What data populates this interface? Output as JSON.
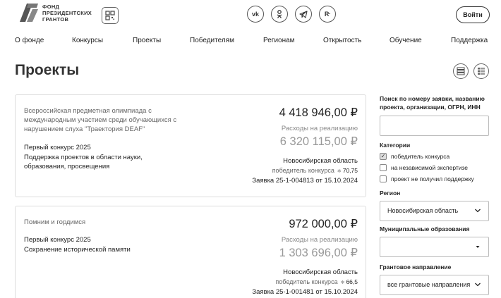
{
  "header": {
    "logo_text": [
      "ФОНД",
      "ПРЕЗИДЕНТСКИХ",
      "ГРАНТОВ"
    ],
    "login_label": "Войти",
    "socials": [
      {
        "icon": "vk-icon",
        "glyph": "vk"
      },
      {
        "icon": "odnoklassniki-icon",
        "glyph": "ok"
      },
      {
        "icon": "telegram-icon",
        "glyph": "tg"
      },
      {
        "icon": "rutube-icon",
        "glyph": "R"
      }
    ]
  },
  "nav": {
    "items": [
      "О фонде",
      "Конкурсы",
      "Проекты",
      "Победителям",
      "Регионам",
      "Открытость",
      "Обучение",
      "Поддержка"
    ]
  },
  "page": {
    "title": "Проекты"
  },
  "projects": [
    {
      "title": "Всероссийская предметная олимпиада с международным участием среди обучающихся с нарушением слуха \"Траектория DEAF\"",
      "contest": "Первый конкурс 2025",
      "direction": "Поддержка проектов в области науки, образования, просвещения",
      "amount": "4 418 946,00 ₽",
      "expenses_label": "Расходы на реализацию",
      "expenses_amount": "6 320 115,00 ₽",
      "region": "Новосибирская область",
      "status": "победитель конкурса",
      "score": "70,75",
      "application": "Заявка 25-1-004813 от 15.10.2024"
    },
    {
      "title": "Помним и гордимся",
      "contest": "Первый конкурс 2025",
      "direction": "Сохранение исторической памяти",
      "amount": "972 000,00 ₽",
      "expenses_label": "Расходы на реализацию",
      "expenses_amount": "1 303 696,00 ₽",
      "region": "Новосибирская область",
      "status": "победитель конкурса",
      "score": "66,5",
      "application": "Заявка 25-1-001481 от 15.10.2024"
    }
  ],
  "sidebar": {
    "search_label": "Поиск по номеру заявки, названию проекта, организации, ОГРН, ИНН",
    "search_value": "",
    "category_label": "Категории",
    "categories": [
      {
        "label": "победитель конкурса",
        "checked": true
      },
      {
        "label": "на независимой экспертизе",
        "checked": false
      },
      {
        "label": "проект не получил поддержку",
        "checked": false
      }
    ],
    "region_label": "Регион",
    "region_value": "Новосибирская область",
    "municipal_label": "Муниципальные образования",
    "municipal_value": "",
    "grant_direction_label": "Грантовое направление",
    "grant_direction_value": "все грантовые направления"
  }
}
